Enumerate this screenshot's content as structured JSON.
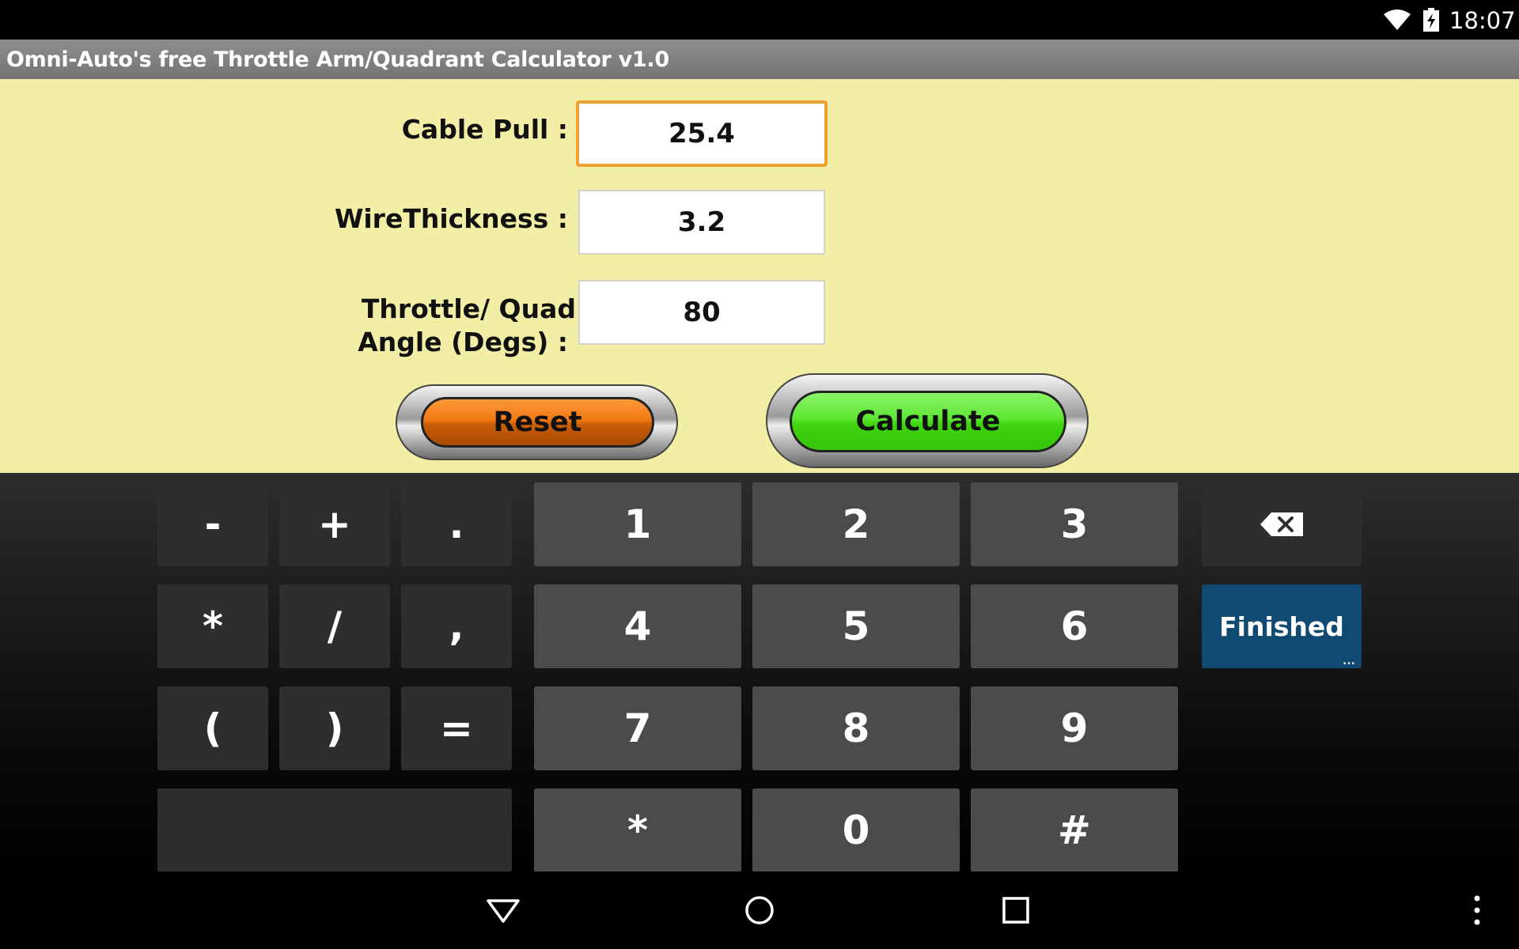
{
  "status_bar": {
    "time": "18:07",
    "icons": [
      "wifi-icon",
      "battery-charging-icon"
    ]
  },
  "app": {
    "title": "Omni-Auto's free Throttle Arm/Quadrant Calculator v1.0"
  },
  "form": {
    "cable_pull": {
      "label": "Cable Pull  :",
      "value": "25.4"
    },
    "wire_thickness": {
      "label": "WireThickness :",
      "value": "3.2"
    },
    "angle": {
      "label_line1": "Throttle/ Quad",
      "label_line2": "Angle (Degs) :",
      "value": "80"
    },
    "reset_label": "Reset",
    "calculate_label": "Calculate"
  },
  "keyboard": {
    "sym_keys": [
      "-",
      "+",
      ".",
      "*",
      "/",
      ",",
      "(",
      ")",
      "="
    ],
    "num_keys": [
      "1",
      "2",
      "3",
      "4",
      "5",
      "6",
      "7",
      "8",
      "9",
      "*",
      "0",
      "#"
    ],
    "done_label": "Finished",
    "done_dots": "...",
    "space_label": ""
  },
  "nav_bar": {
    "buttons": [
      "back-icon",
      "home-icon",
      "recents-icon",
      "overflow-menu-icon"
    ]
  },
  "colors": {
    "form_background": "#f2eea6",
    "reset_button": "#f07812",
    "calculate_button": "#4fe020",
    "focus_border": "#f0a030",
    "done_key": "#0e4a72"
  }
}
